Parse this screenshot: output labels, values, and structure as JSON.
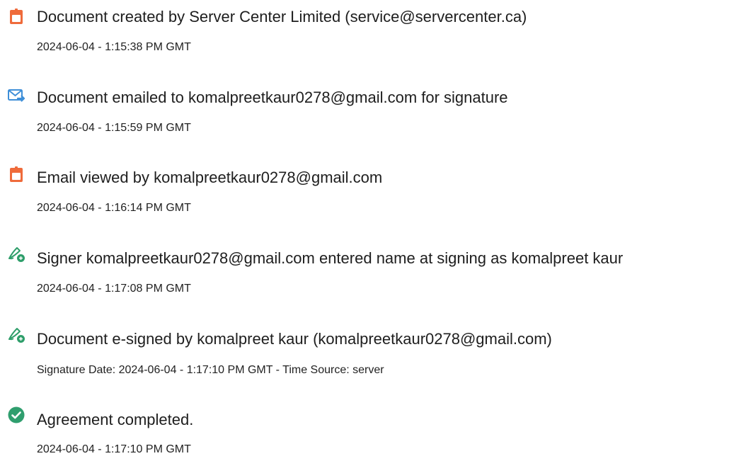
{
  "colors": {
    "doc_icon": "#ef6b3b",
    "email_icon": "#3f8fd8",
    "sign_icon": "#2e9e6a",
    "complete_icon": "#2f9e6e"
  },
  "events": [
    {
      "icon": "document-icon",
      "title": "Document created by Server Center Limited (service@servercenter.ca)",
      "detail": "2024-06-04 - 1:15:38 PM GMT"
    },
    {
      "icon": "email-icon",
      "title": "Document emailed to komalpreetkaur0278@gmail.com for signature",
      "detail": "2024-06-04 - 1:15:59 PM GMT"
    },
    {
      "icon": "document-icon",
      "title": "Email viewed by komalpreetkaur0278@gmail.com",
      "detail": "2024-06-04 - 1:16:14 PM GMT"
    },
    {
      "icon": "signature-icon",
      "title": "Signer komalpreetkaur0278@gmail.com entered name at signing as komalpreet kaur",
      "detail": "2024-06-04 - 1:17:08 PM GMT"
    },
    {
      "icon": "signature-icon",
      "title": "Document e-signed by komalpreet kaur (komalpreetkaur0278@gmail.com)",
      "detail": "Signature Date: 2024-06-04 - 1:17:10 PM GMT - Time Source: server"
    },
    {
      "icon": "checkmark-icon",
      "title": "Agreement completed.",
      "detail": "2024-06-04 - 1:17:10 PM GMT"
    }
  ]
}
